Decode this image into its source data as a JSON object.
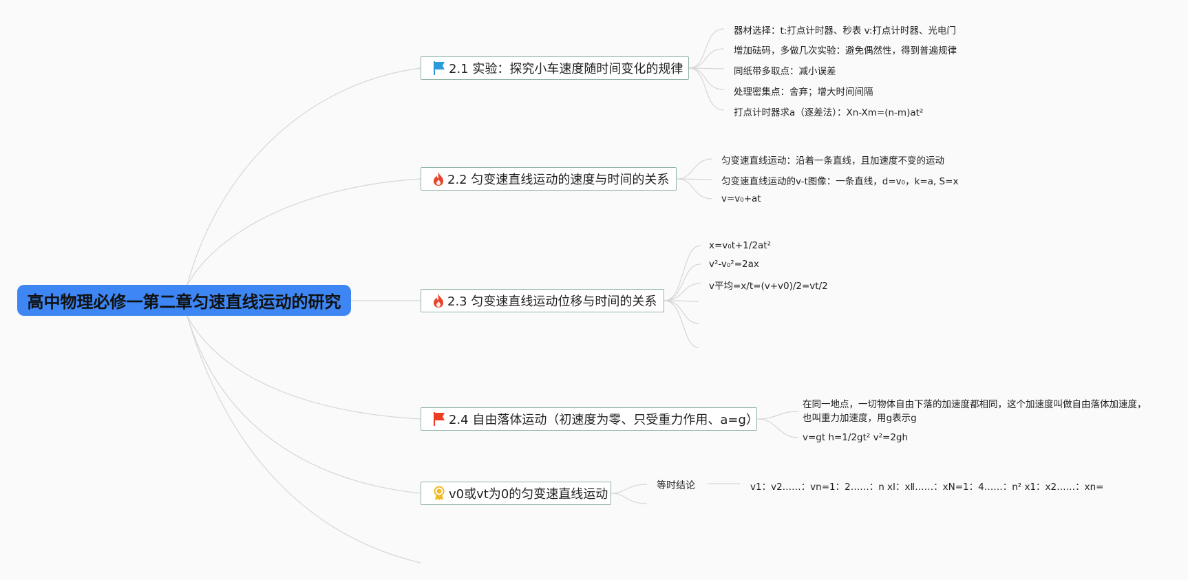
{
  "root": {
    "label": "高中物理必修一第二章匀速直线运动的研究"
  },
  "topics": [
    {
      "icon": "blue-flag-icon",
      "label": "2.1 实验：探究小车速度随时间变化的规律",
      "children": [
        "器材选择：t:打点计时器、秒表 v:打点计时器、光电门",
        "增加砝码，多做几次实验：避免偶然性，得到普遍规律",
        "同纸带多取点：减小误差",
        "处理密集点：舍弃；增大时间间隔",
        "打点计时器求a（逐差法）：Xn-Xm=(n-m)at²"
      ]
    },
    {
      "icon": "fire-icon",
      "label": "2.2 匀变速直线运动的速度与时间的关系",
      "children": [
        "匀变速直线运动：沿着一条直线，且加速度不变的运动",
        "匀变速直线运动的v-t图像：一条直线，d=v₀，k=a, S=x",
        "v=v₀+at"
      ]
    },
    {
      "icon": "fire-icon",
      "label": "2.3 匀变速直线运动位移与时间的关系",
      "children": [
        "x=v₀t+1/2at²",
        "v²-v₀²=2ax",
        "v平均=x/t=(v+v0)/2=vt/2"
      ]
    },
    {
      "icon": "red-flag-icon",
      "label": "2.4 自由落体运动（初速度为零、只受重力作用、a=g）",
      "children": [
        "在同一地点，一切物体自由下落的加速度都相同，这个加速度叫做自由落体加速度，也叫重力加速度，用g表示g",
        "v=gt h=1/2gt² v²=2gh"
      ]
    },
    {
      "icon": "award-medal-icon",
      "label": "v0或vt为0的匀变速直线运动",
      "subtopic": "等时结论",
      "children": [
        "v1：v2……：vn=1：2……：n xⅠ：xⅡ……：xN=1：4……：n² x1：x2……：xn="
      ]
    }
  ],
  "colors": {
    "root_bg": "#3d86f3",
    "topic_border": "#8fb3a3",
    "connector": "#d6d6d6",
    "fire": "#e8452c",
    "blue_flag": "#2b9ad8",
    "red_flag": "#ee3b24",
    "medal": "#f2b824"
  }
}
